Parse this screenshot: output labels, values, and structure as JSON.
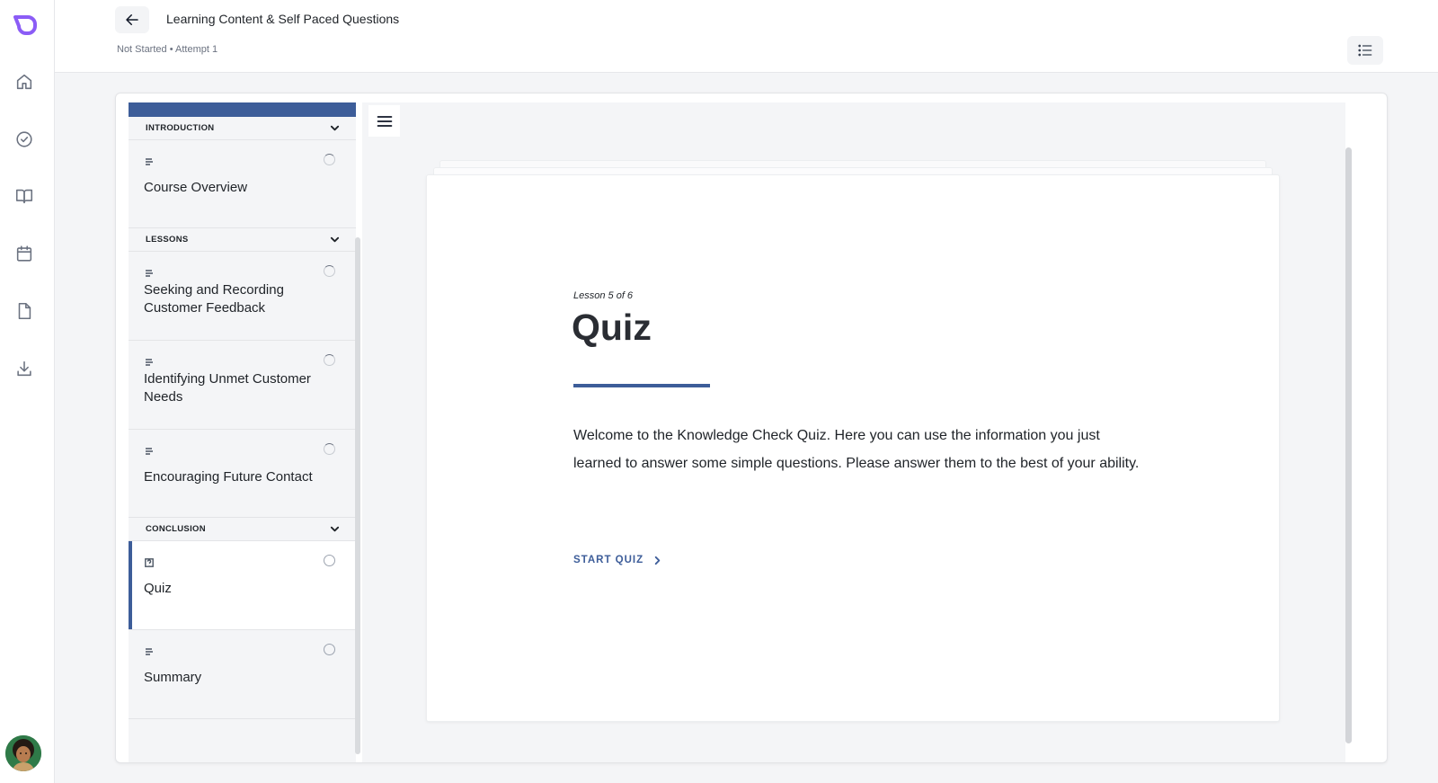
{
  "app": {
    "icons": [
      "logo-icon",
      "home-icon",
      "badge-check-icon",
      "book-icon",
      "calendar-icon",
      "file-icon",
      "download-icon"
    ]
  },
  "header": {
    "title": "Learning Content & Self Paced Questions",
    "status": "Not Started • Attempt 1"
  },
  "sidebar": {
    "sections": [
      {
        "label": "INTRODUCTION",
        "lessons": [
          {
            "name": "Course Overview",
            "type": "text",
            "status": "partial"
          }
        ]
      },
      {
        "label": "LESSONS",
        "lessons": [
          {
            "name": "Seeking and Recording Customer Feedback",
            "type": "text",
            "status": "partial"
          },
          {
            "name": "Identifying Unmet Customer Needs",
            "type": "text",
            "status": "partial"
          },
          {
            "name": "Encouraging Future Contact",
            "type": "text",
            "status": "partial"
          }
        ]
      },
      {
        "label": "CONCLUSION",
        "lessons": [
          {
            "name": "Quiz",
            "type": "quiz",
            "status": "empty",
            "active": true
          },
          {
            "name": "Summary",
            "type": "text",
            "status": "empty"
          }
        ]
      }
    ]
  },
  "content": {
    "eyebrow": "Lesson 5 of 6",
    "title": "Quiz",
    "body": "Welcome to the Knowledge Check Quiz. Here you can use the information you just learned to answer some simple questions. Please answer them to the best of your ability.",
    "start_label": "START QUIZ"
  },
  "colors": {
    "accent": "#3d5d99",
    "logo": "#8b5cf6"
  }
}
